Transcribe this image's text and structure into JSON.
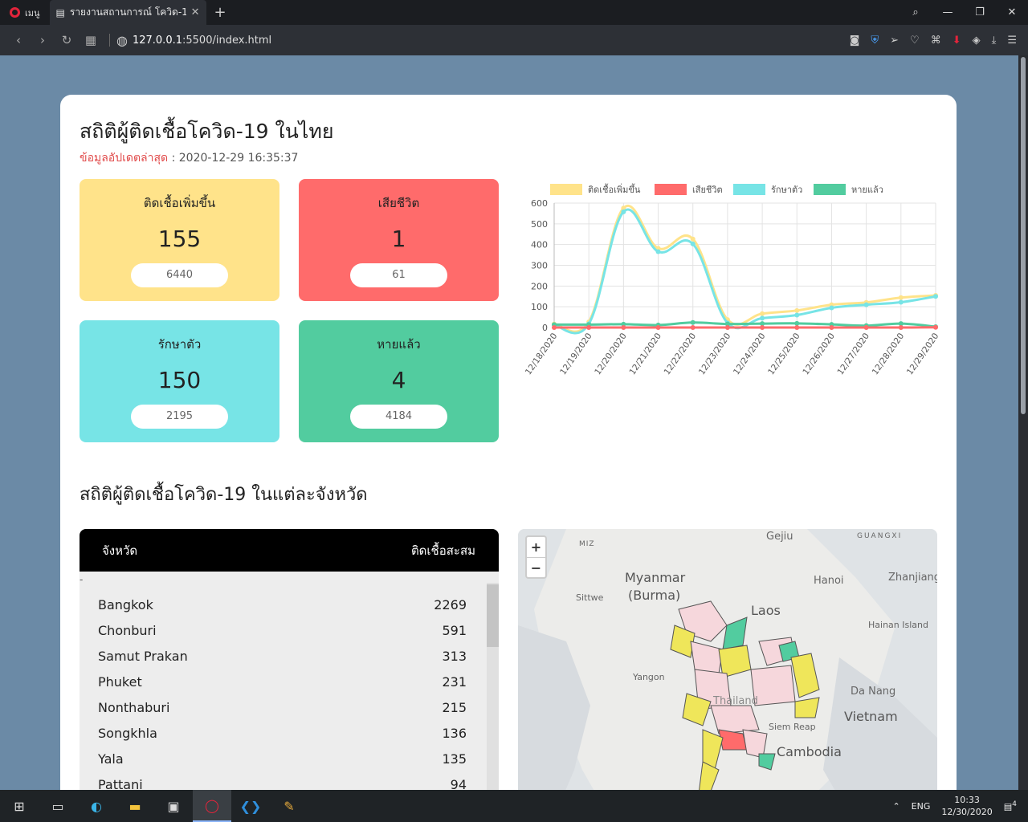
{
  "browser": {
    "menu_label": "เมนู",
    "tab_title": "รายงานสถานการณ์ โควิด-19",
    "url_host": "127.0.0.1",
    "url_rest": ":5500/index.html"
  },
  "page": {
    "title": "สถิติผู้ติดเชื้อโควิด-19 ในไทย",
    "updated_label": "ข้อมูลอัปเดตล่าสุด",
    "updated_value": ": 2020-12-29 16:35:37",
    "section_title": "สถิติผู้ติดเชื้อโควิด-19 ในแต่ละจังหวัด"
  },
  "stats": [
    {
      "label": "ติดเชื้อเพิ่มขึ้น",
      "value": "155",
      "total": "6440",
      "color": "#ffe38a"
    },
    {
      "label": "เสียชีวิต",
      "value": "1",
      "total": "61",
      "color": "#ff6b6b"
    },
    {
      "label": "รักษาตัว",
      "value": "150",
      "total": "2195",
      "color": "#77e4e6"
    },
    {
      "label": "หายแล้ว",
      "value": "4",
      "total": "4184",
      "color": "#52cc9f"
    }
  ],
  "chart_data": {
    "type": "line",
    "categories": [
      "12/18/2020",
      "12/19/2020",
      "12/20/2020",
      "12/21/2020",
      "12/22/2020",
      "12/23/2020",
      "12/24/2020",
      "12/25/2020",
      "12/26/2020",
      "12/27/2020",
      "12/28/2020",
      "12/29/2020"
    ],
    "series": [
      {
        "name": "ติดเชื้อเพิ่มขึ้น",
        "color": "#ffe38a",
        "values": [
          17,
          27,
          576,
          382,
          427,
          38,
          67,
          82,
          110,
          121,
          144,
          155
        ]
      },
      {
        "name": "เสียชีวิต",
        "color": "#ff6b6b",
        "values": [
          0,
          0,
          0,
          0,
          0,
          0,
          0,
          0,
          0,
          0,
          0,
          1
        ]
      },
      {
        "name": "รักษาตัว",
        "color": "#77e4e6",
        "values": [
          12,
          18,
          558,
          366,
          403,
          22,
          45,
          60,
          95,
          110,
          122,
          150
        ]
      },
      {
        "name": "หายแล้ว",
        "color": "#52cc9f",
        "values": [
          14,
          14,
          16,
          12,
          24,
          17,
          19,
          20,
          15,
          9,
          19,
          4
        ]
      }
    ],
    "ylim": [
      0,
      600
    ],
    "yticks": [
      "0",
      "100",
      "200",
      "300",
      "400",
      "500",
      "600"
    ],
    "legend": "top",
    "grid": true
  },
  "province_table": {
    "col_province": "จังหวัด",
    "col_cases": "ติดเชื้อสะสม",
    "dash": "-",
    "rows": [
      {
        "name": "Bangkok",
        "cases": "2269"
      },
      {
        "name": "Chonburi",
        "cases": "591"
      },
      {
        "name": "Samut Prakan",
        "cases": "313"
      },
      {
        "name": "Phuket",
        "cases": "231"
      },
      {
        "name": "Nonthaburi",
        "cases": "215"
      },
      {
        "name": "Songkhla",
        "cases": "136"
      },
      {
        "name": "Yala",
        "cases": "135"
      },
      {
        "name": "Pattani",
        "cases": "94"
      }
    ]
  },
  "map": {
    "zoom_in": "+",
    "zoom_out": "−",
    "labels": {
      "myanmar": "Myanmar",
      "burma": "(Burma)",
      "laos": "Laos",
      "vietnam": "Vietnam",
      "cambodia": "Cambodia",
      "thailand": "Thailand",
      "gejiu": "Gejiu",
      "guangxi": "GUANGXI",
      "hanoi": "Hanoi",
      "zhanjiang": "Zhanjiang",
      "hainan": "Hainan Island",
      "sittwe": "Sittwe",
      "yangon": "Yangon",
      "danang": "Da Nang",
      "siemreap": "Siem Reap",
      "miz": "MIZ"
    }
  },
  "taskbar": {
    "lang": "ENG",
    "time": "10:33",
    "date": "12/30/2020",
    "notif_count": "4"
  }
}
